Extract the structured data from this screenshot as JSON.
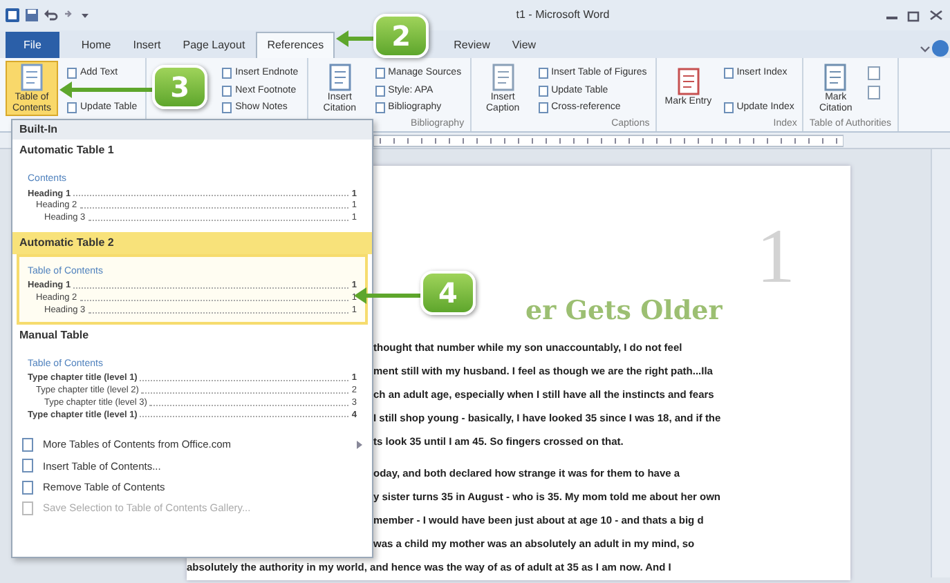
{
  "window": {
    "title": "t1 - Microsoft Word"
  },
  "tabs": [
    {
      "label": "File",
      "selected": false,
      "kind": "file"
    },
    {
      "label": "Home",
      "selected": false,
      "kind": "tab"
    },
    {
      "label": "Insert",
      "selected": false,
      "kind": "tab"
    },
    {
      "label": "Page Layout",
      "selected": false,
      "kind": "tab"
    },
    {
      "label": "References",
      "selected": true,
      "kind": "tab"
    },
    {
      "label": "Review",
      "selected": false,
      "kind": "tab"
    },
    {
      "label": "View",
      "selected": false,
      "kind": "tab"
    }
  ],
  "ribbon": {
    "groups": [
      {
        "large": {
          "label": "Table of Contents",
          "pressed": true
        },
        "small": [
          "Add Text",
          "Update Table"
        ]
      },
      {
        "small": [
          "Insert Endnote",
          "Next Footnote",
          "Show Notes"
        ]
      },
      {
        "label": "Bibliography",
        "large": {
          "label": "Insert Citation",
          "pressed": false
        },
        "small": [
          "Manage Sources",
          "Style: APA",
          "Bibliography"
        ]
      },
      {
        "label": "Captions",
        "large": {
          "label": "Insert Caption",
          "pressed": false
        },
        "small": [
          "Insert Table of Figures",
          "Update Table",
          "Cross-reference"
        ]
      },
      {
        "label": "Index",
        "large": {
          "label": "Mark Entry",
          "pressed": false
        },
        "small": [
          "Insert Index",
          "Update Index"
        ]
      },
      {
        "label": "Table of Authorities",
        "large": {
          "label": "Mark Citation",
          "pressed": false
        }
      }
    ]
  },
  "toc_menu": {
    "section": "Built-In",
    "galleries": [
      {
        "title": "Automatic Table 1",
        "selected": false,
        "heading": "Contents",
        "entries": [
          {
            "text": "Heading 1",
            "page": "1",
            "children": [
              {
                "text": "Heading 2",
                "page": "1",
                "children": [
                  {
                    "text": "Heading 3",
                    "page": "1"
                  }
                ]
              }
            ]
          }
        ]
      },
      {
        "title": "Automatic Table 2",
        "selected": true,
        "heading": "Table of Contents",
        "entries": [
          {
            "text": "Heading 1",
            "page": "1",
            "children": [
              {
                "text": "Heading 2",
                "page": "1",
                "children": [
                  {
                    "text": "Heading 3",
                    "page": "1"
                  }
                ]
              }
            ]
          }
        ]
      },
      {
        "title": "Manual Table",
        "selected": false,
        "heading": "Table of Contents",
        "entries": [
          {
            "text": "Type chapter title (level 1)",
            "page": "1",
            "children": [
              {
                "text": "Type chapter title (level 2)",
                "page": "2",
                "children": [
                  {
                    "text": "Type chapter title (level 3)",
                    "page": "3"
                  }
                ]
              }
            ]
          },
          {
            "text": "Type chapter title (level 1)",
            "page": "4"
          }
        ]
      }
    ],
    "commands": [
      {
        "label": "More Tables of Contents from Office.com",
        "disabled": false,
        "submenu": true
      },
      {
        "label": "Insert Table of Contents...",
        "disabled": false,
        "submenu": false
      },
      {
        "label": "Remove Table of Contents",
        "disabled": false,
        "submenu": false
      },
      {
        "label": "Save Selection to Table of Contents Gallery...",
        "disabled": true,
        "submenu": false
      }
    ]
  },
  "document": {
    "page_number": "1",
    "heading": "er Gets Older",
    "paragraphs": [
      [
        "thought that number while my son unaccountably, I do not feel",
        "ment still with my husband. I feel as though we are the right path...Ila",
        "ch an adult age, especially when I still have all the instincts and fears",
        "I still shop young - basically, I have looked 35 since I was 18, and if the",
        "ts look 35 until I am 45. So fingers crossed on that."
      ],
      [
        "oday, and both declared how strange it was for them to have a",
        "y sister turns 35 in August - who is 35. My mom told me about her own",
        "member - I would have been just about at age 10 - and thats a big d",
        "was a child my mother was an absolutely an adult in my mind, so"
      ]
    ],
    "last_line": "absolutely the authority in my world, and hence was the way of as of adult at 35 as I am now. And I"
  },
  "callouts": [
    {
      "label": "2"
    },
    {
      "label": "3"
    },
    {
      "label": "4"
    }
  ]
}
